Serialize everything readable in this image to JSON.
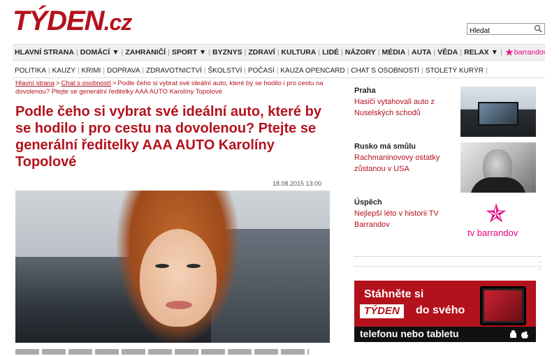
{
  "header": {
    "logo_main": "TÝDEN",
    "logo_suffix": ".cz",
    "search_value": "Hledat"
  },
  "topnav": {
    "items": [
      "HLAVNÍ STRANA",
      "DOMÁCÍ ▼",
      "ZAHRANIČÍ",
      "SPORT ▼",
      "BYZNYS",
      "ZDRAVÍ",
      "KULTURA",
      "LIDÉ",
      "NÁZORY",
      "MÉDIA",
      "AUTA",
      "VĚDA",
      "RELAX ▼"
    ],
    "star": "✯",
    "brand": "barrandov"
  },
  "subnav": {
    "items": [
      "POLITIKA",
      "KAUZY",
      "KRIMI",
      "DOPRAVA",
      "ZDRAVOTNICTVÍ",
      "ŠKOLSTVÍ",
      "POČASÍ",
      "KAUZA OPENCARD",
      "CHAT S OSOBNOSTÍ",
      "STOLETÝ KURÝR"
    ]
  },
  "breadcrumb": {
    "home": "Hlavní strana",
    "section": "Chat s osobností",
    "current": "Podle čeho si vybrat své ideální auto, které by se hodilo i pro cestu na dovolenou? Ptejte se generální ředitelky AAA AUTO Karolíny Topolové"
  },
  "article": {
    "headline": "Podle čeho si vybrat své ideální auto, které by se hodilo i pro cestu na dovolenou? Ptejte se generální ředitelky AAA AUTO Karolíny Topolové",
    "date": "18.08.2015 13:00"
  },
  "sidebar": {
    "news": [
      {
        "category": "Praha",
        "title": "Hasiči vytahovali auto z Nuselských schodů"
      },
      {
        "category": "Rusko má smůlu",
        "title": "Rachmaninovovy ostatky zůstanou v USA"
      },
      {
        "category": "Úspěch",
        "title": "Nejlepší léto v historii TV Barrandov"
      }
    ],
    "tv_logo": "tv barrandov"
  },
  "ad": {
    "line1": "Stáhněte si",
    "logo": "TÝDEN",
    "line2": "do svého",
    "line3": "telefonu nebo tabletu"
  }
}
